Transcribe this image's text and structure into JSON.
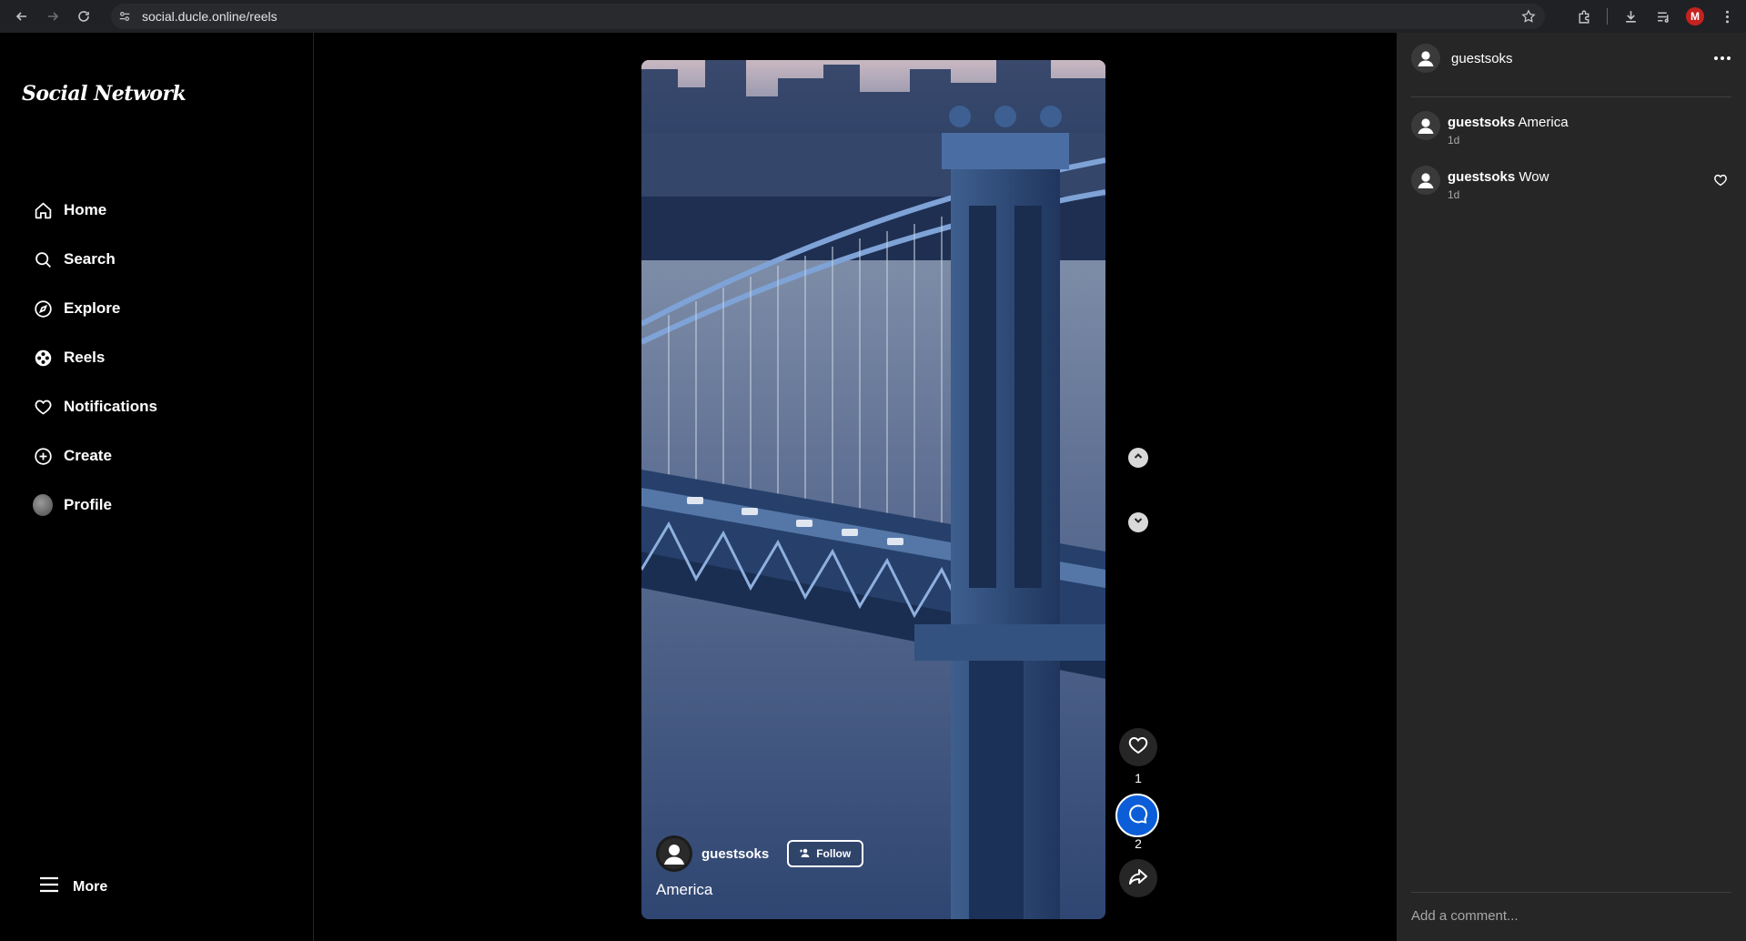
{
  "browser": {
    "url": "social.ducle.online/reels",
    "profile_initial": "M"
  },
  "sidebar": {
    "brand": "Social Network",
    "items": [
      {
        "label": "Home",
        "icon": "home-icon"
      },
      {
        "label": "Search",
        "icon": "search-icon"
      },
      {
        "label": "Explore",
        "icon": "compass-icon"
      },
      {
        "label": "Reels",
        "icon": "reels-icon"
      },
      {
        "label": "Notifications",
        "icon": "heart-icon"
      },
      {
        "label": "Create",
        "icon": "plus-circle-icon"
      },
      {
        "label": "Profile",
        "icon": "profile-avatar"
      }
    ],
    "more_label": "More"
  },
  "reel": {
    "username": "guestsoks",
    "follow_label": "Follow",
    "caption": "America",
    "likes": "1",
    "comments": "2"
  },
  "panel": {
    "owner": "guestsoks",
    "comments": [
      {
        "user": "guestsoks",
        "text": "America",
        "time": "1d"
      },
      {
        "user": "guestsoks",
        "text": "Wow",
        "time": "1d"
      }
    ],
    "input_placeholder": "Add a comment..."
  }
}
